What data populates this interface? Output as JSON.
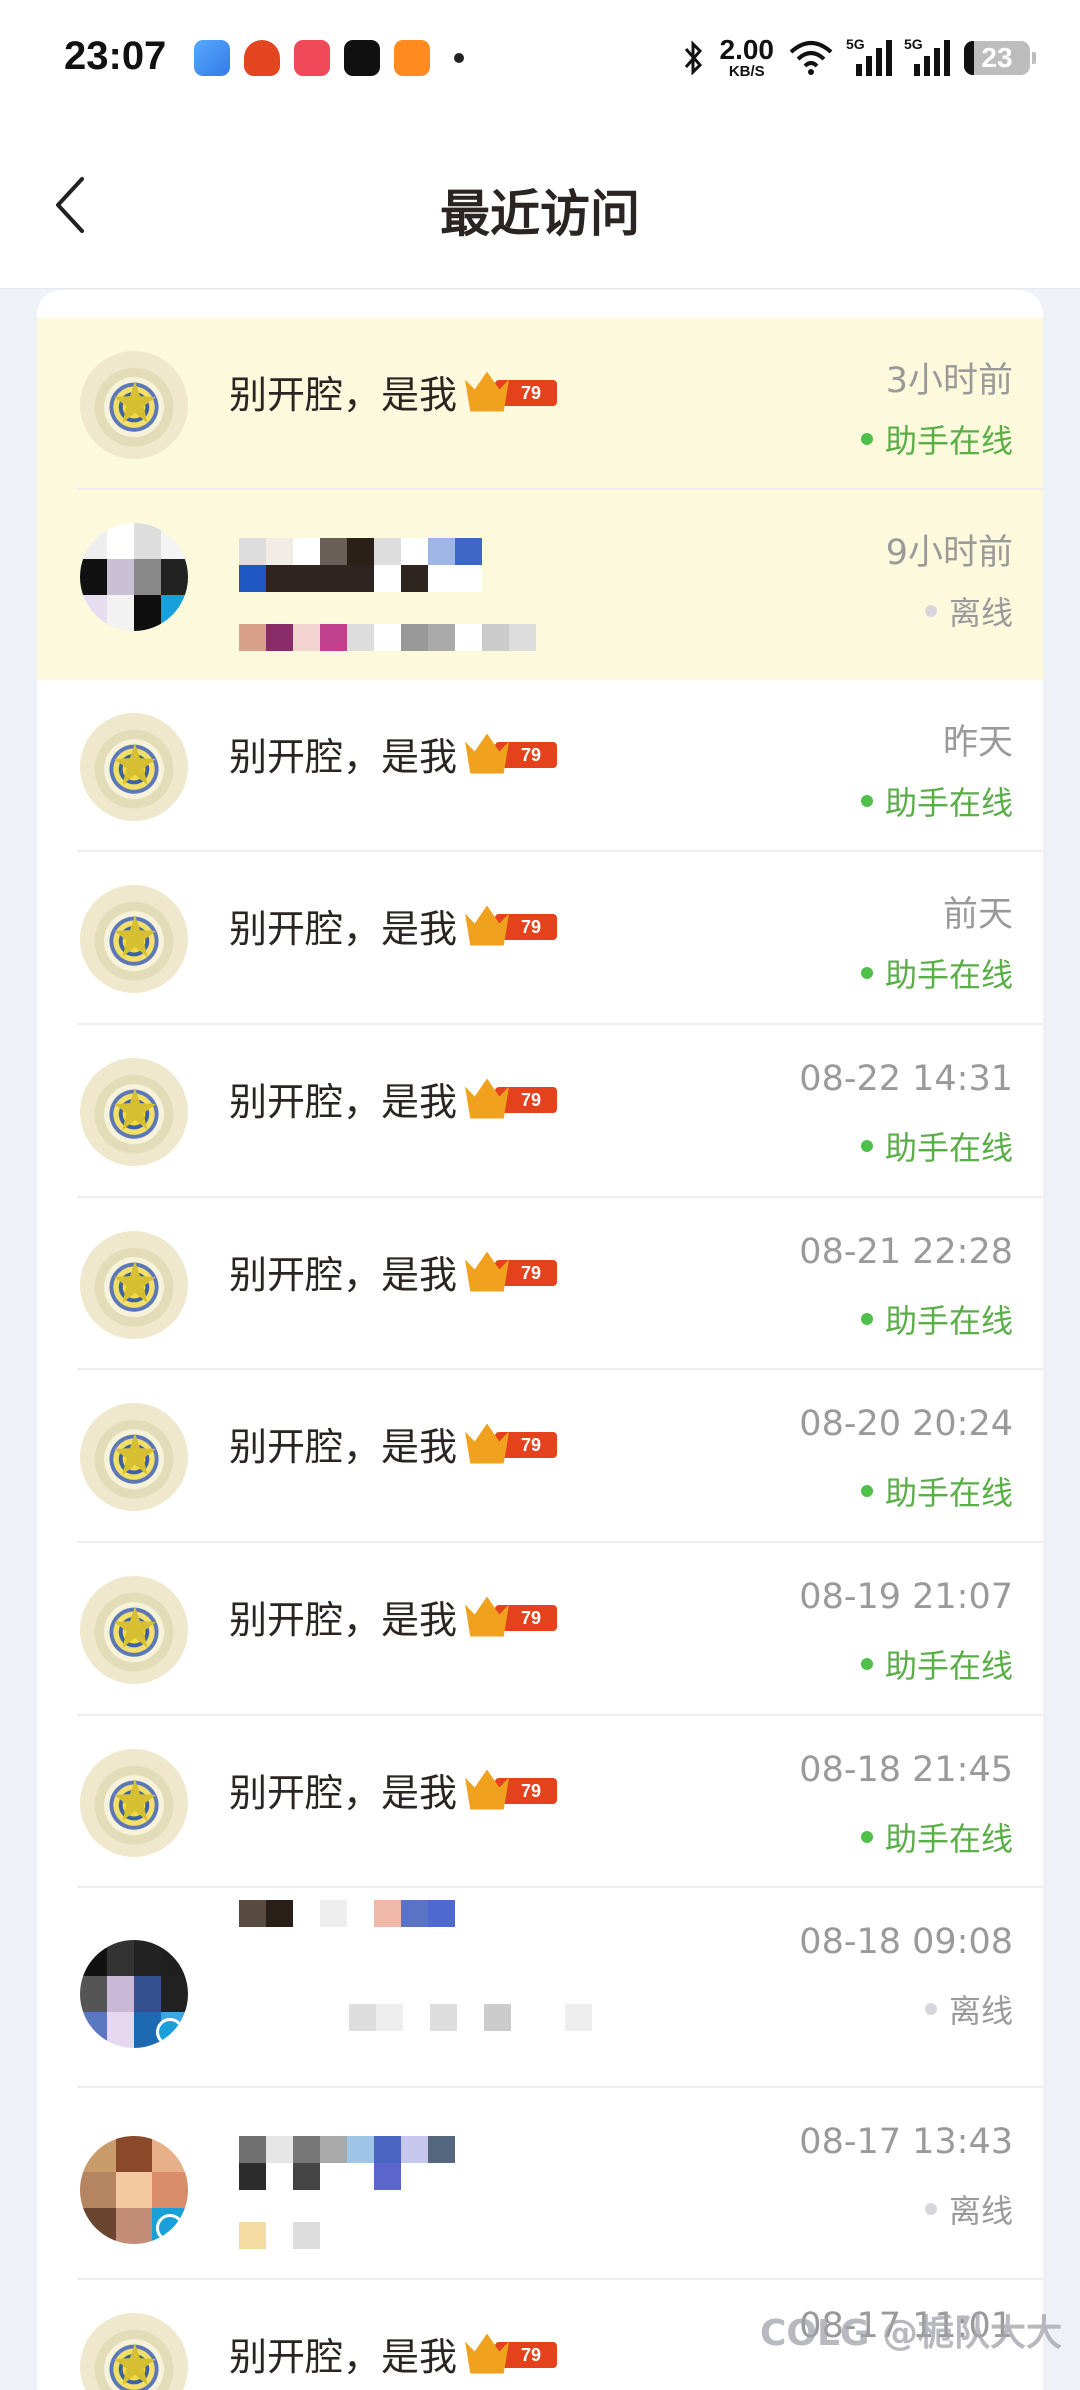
{
  "status_bar": {
    "time": "23:07",
    "net_speed": "2.00",
    "net_unit": "KB/S",
    "sim1": "5G",
    "sim2": "5G",
    "battery": "23",
    "app_icons": [
      "weather-icon",
      "app-icon-red-1",
      "app-icon-red-2",
      "tiktok-icon",
      "app-icon-orange"
    ]
  },
  "header": {
    "title": "最近访问"
  },
  "colors": {
    "highlight_row": "#fdf9dd",
    "online_green": "#5aae47",
    "muted_gray": "#9a9a9a",
    "badge_red": "#e3421c",
    "badge_gold": "#f0a21f"
  },
  "visitors": [
    {
      "name": "别开腔，是我",
      "level": "79",
      "time": "3小时前",
      "status": "助手在线",
      "online": true,
      "highlight": true
    },
    {
      "name": "",
      "level": "",
      "time": "9小时前",
      "status": "离线",
      "online": false,
      "highlight": true
    },
    {
      "name": "别开腔，是我",
      "level": "79",
      "time": "昨天",
      "status": "助手在线",
      "online": true,
      "highlight": false
    },
    {
      "name": "别开腔，是我",
      "level": "79",
      "time": "前天",
      "status": "助手在线",
      "online": true,
      "highlight": false
    },
    {
      "name": "别开腔，是我",
      "level": "79",
      "time": "08-22 14:31",
      "status": "助手在线",
      "online": true,
      "highlight": false
    },
    {
      "name": "别开腔，是我",
      "level": "79",
      "time": "08-21 22:28",
      "status": "助手在线",
      "online": true,
      "highlight": false
    },
    {
      "name": "别开腔，是我",
      "level": "79",
      "time": "08-20 20:24",
      "status": "助手在线",
      "online": true,
      "highlight": false
    },
    {
      "name": "别开腔，是我",
      "level": "79",
      "time": "08-19 21:07",
      "status": "助手在线",
      "online": true,
      "highlight": false
    },
    {
      "name": "别开腔，是我",
      "level": "79",
      "time": "08-18 21:45",
      "status": "助手在线",
      "online": true,
      "highlight": false
    },
    {
      "name": "",
      "level": "",
      "time": "08-18 09:08",
      "status": "离线",
      "online": false,
      "highlight": false
    },
    {
      "name": "",
      "level": "",
      "time": "08-17 13:43",
      "status": "离线",
      "online": false,
      "highlight": false
    },
    {
      "name": "别开腔，是我",
      "level": "79",
      "time": "08-17 11:01",
      "status": "",
      "online": true,
      "highlight": false
    }
  ],
  "watermark": "COLG @栀队大大"
}
